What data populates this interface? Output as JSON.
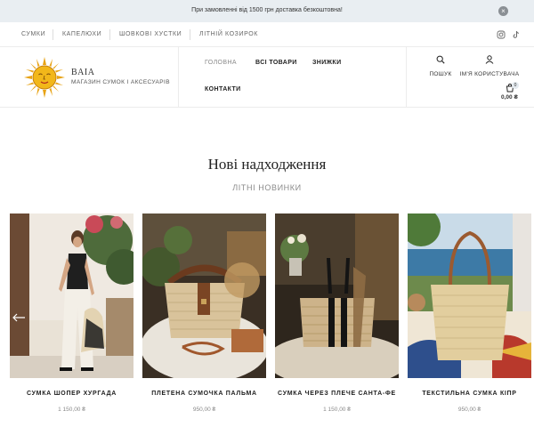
{
  "announcement": {
    "text": "При замовленні від 1500 грн доставка безкоштовна!",
    "close_icon": "close-icon"
  },
  "top_links": [
    "СУМКИ",
    "КАПЕЛЮХИ",
    "ШОВКОВІ ХУСТКИ",
    "ЛІТНІЙ КОЗИРОК"
  ],
  "social": [
    "instagram-icon",
    "tiktok-icon"
  ],
  "brand": {
    "name": "BAIA",
    "tagline": "МАГАЗИН СУМОК І АКСЕСУАРІВ",
    "logo_icon": "sun-logo-icon"
  },
  "nav": {
    "home": "ГОЛОВНА",
    "all": "ВСІ ТОВАРИ",
    "sale": "ЗНИЖКИ",
    "contacts": "КОНТАКТИ"
  },
  "header_actions": {
    "search": "ПОШУК",
    "account": "ІМ'Я КОРИСТУВАЧА",
    "cart_count": "0",
    "cart_total": "0,00 ₴"
  },
  "section": {
    "title": "Нові надходження",
    "subtitle": "ЛІТНІ НОВИНКИ"
  },
  "products": [
    {
      "name": "СУМКА ШОПЕР ХУРГАДА",
      "price": "1 150,00 ₴"
    },
    {
      "name": "ПЛЕТЕНА СУМОЧКА ПАЛЬМА",
      "price": "950,00 ₴"
    },
    {
      "name": "СУМКА ЧЕРЕЗ ПЛЕЧЕ САНТА-ФЕ",
      "price": "1 150,00 ₴"
    },
    {
      "name": "ТЕКСТИЛЬНА СУМКА КІПР",
      "price": "950,00 ₴"
    }
  ],
  "colors": {
    "announce_bg": "#e9eef2",
    "text_dark": "#1f1f1f",
    "muted": "#8a8a8a"
  }
}
